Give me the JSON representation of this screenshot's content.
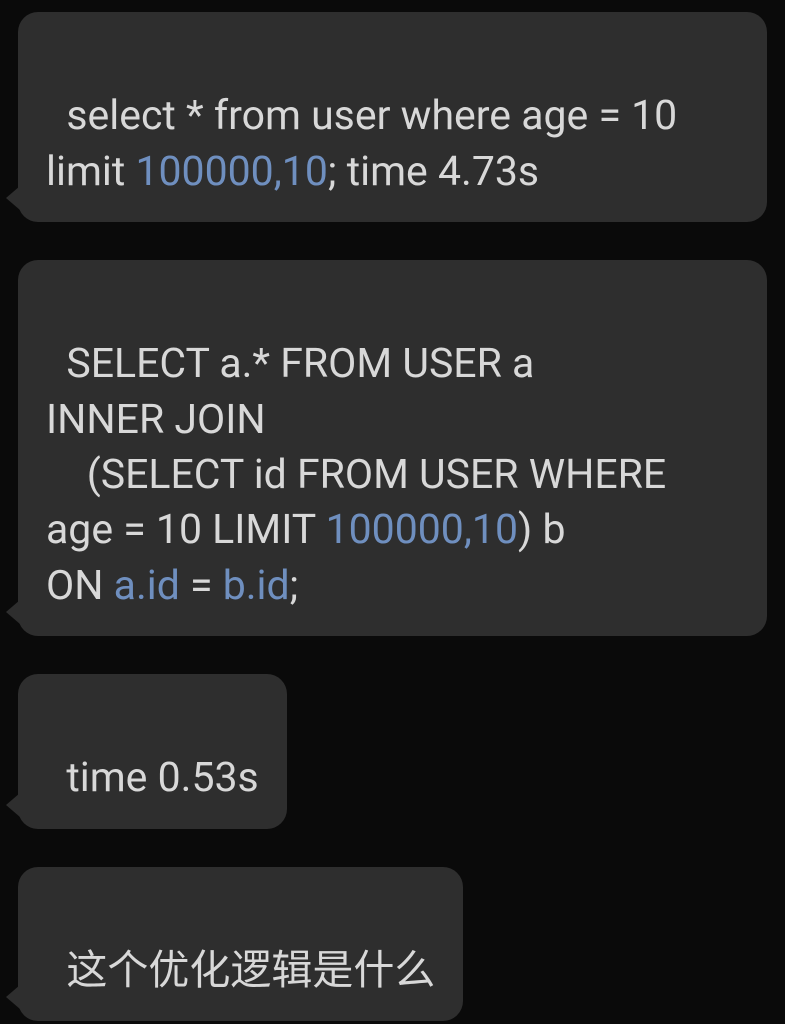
{
  "messages": [
    {
      "segments": [
        {
          "text": "select * from user where age = 10 limit ",
          "style": "plain"
        },
        {
          "text": "100000,10",
          "style": "link"
        },
        {
          "text": "; time 4.73s",
          "style": "plain"
        }
      ]
    },
    {
      "segments": [
        {
          "text": "SELECT a.* FROM USER a\nINNER JOIN\n    (SELECT id FROM USER WHERE age = 10 LIMIT ",
          "style": "plain"
        },
        {
          "text": "100000,10",
          "style": "link"
        },
        {
          "text": ") b\nON ",
          "style": "plain"
        },
        {
          "text": "a.id",
          "style": "link"
        },
        {
          "text": " = ",
          "style": "plain"
        },
        {
          "text": "b.id",
          "style": "link"
        },
        {
          "text": ";",
          "style": "plain"
        }
      ]
    },
    {
      "segments": [
        {
          "text": "time 0.53s",
          "style": "plain"
        }
      ]
    },
    {
      "segments": [
        {
          "text": "这个优化逻辑是什么",
          "style": "plain"
        }
      ]
    }
  ]
}
